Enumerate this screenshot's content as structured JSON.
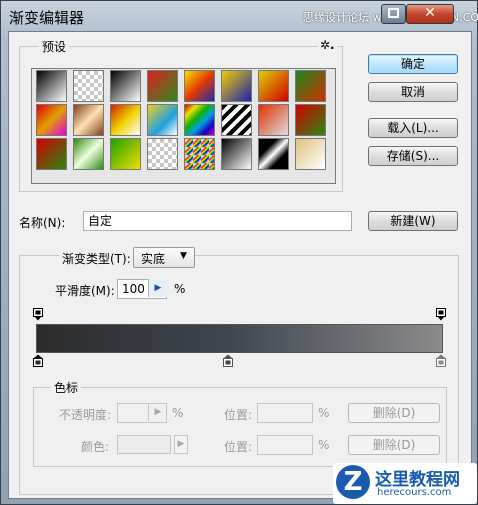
{
  "window": {
    "title": "渐变编辑器",
    "watermark_top": "思缘设计论坛 www.MISSYUAN.COM"
  },
  "presets": {
    "group_title": "预设",
    "gear_glyph": "✲.",
    "rows": [
      [
        "linear-gradient(135deg,#000,#fff)",
        "checker-fade-black",
        "linear-gradient(135deg,#000 0%,#fff 100%)",
        "linear-gradient(135deg,#e02020,#2d8a1d)",
        "linear-gradient(135deg,#f7e000,#e23a00 50%,#1c2bb3)",
        "linear-gradient(135deg,#f0d000,#1b20b0)",
        "linear-gradient(135deg,#e0d000,#d00000)",
        "linear-gradient(135deg,#1e8a20,#d03000)"
      ],
      [
        "linear-gradient(135deg,#e00010,#e0a000,#e000e0)",
        "linear-gradient(135deg,#804020,#ffe0b0,#804020)",
        "linear-gradient(135deg,#d02000,#f0d000,#fff)",
        "linear-gradient(135deg,#f0d020,#20a0e0 60%,#fff)",
        "linear-gradient(135deg,#d00000,#f0e000,#10b000,#00a0e0,#2000c0,#c000c0)",
        "stripes",
        "linear-gradient(135deg,#e03000,transparent)",
        "linear-gradient(135deg,#d00000,#2a8a10)"
      ],
      [
        "linear-gradient(135deg,#d00000,#2a8a10)",
        "linear-gradient(135deg,#2a8a10,#f0ffe0,#2a8a10)",
        "linear-gradient(135deg,#20a000,#f0e000)",
        "checker-plain",
        "checker-rainbow",
        "linear-gradient(135deg,#000,#fff)",
        "linear-gradient(135deg,#000 30%,#fff 50%,#000 70%)",
        "linear-gradient(135deg,#e0c080,#fff)"
      ]
    ]
  },
  "buttons": {
    "ok": "确定",
    "cancel": "取消",
    "load": "载入(L)...",
    "save": "存储(S)...",
    "new": "新建(W)"
  },
  "name_field": {
    "label": "名称(N):",
    "value": "自定"
  },
  "gradient_type": {
    "label": "渐变类型(T):",
    "value": "实底"
  },
  "smoothness": {
    "label": "平滑度(M):",
    "value": "100",
    "unit": "%"
  },
  "gradient_bar": {
    "colors": [
      "#2b2b2b",
      "#3f4550",
      "#8b8b8b"
    ]
  },
  "color_stops": {
    "group_title": "色标",
    "opacity_label": "不透明度:",
    "opacity_unit": "%",
    "location_label": "位置:",
    "location_unit": "%",
    "delete_label": "删除(D)",
    "color_label": "颜色:"
  },
  "watermark_logo": {
    "site_name": "这里教程网",
    "url": "herecours.com"
  },
  "colors": {
    "ok_border": "#3c7fb1",
    "title_close": "#c4452d"
  }
}
